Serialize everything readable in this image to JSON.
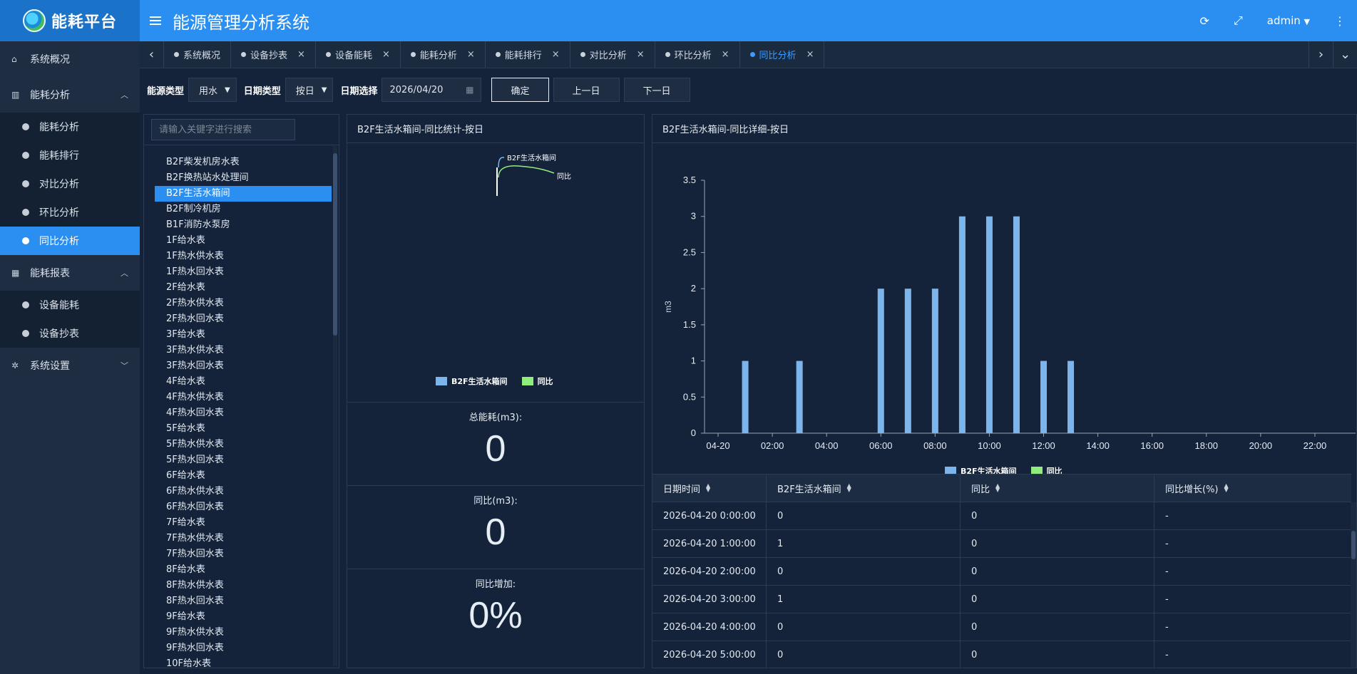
{
  "header": {
    "logo_text": "能耗平台",
    "title": "能源管理分析系统",
    "user": "admin",
    "icons": [
      "refresh-icon",
      "fullscreen-icon",
      "user-caret-icon",
      "more-icon"
    ]
  },
  "sidebar": {
    "groups": [
      {
        "label": "系统概况",
        "icon": "home-icon"
      },
      {
        "label": "能耗分析",
        "icon": "bar-chart-icon",
        "expanded": true,
        "items": [
          "能耗分析",
          "能耗排行",
          "对比分析",
          "环比分析",
          "同比分析"
        ],
        "active": 4
      },
      {
        "label": "能耗报表",
        "icon": "table-icon",
        "expanded": true,
        "items": [
          "设备能耗",
          "设备抄表"
        ]
      },
      {
        "label": "系统设置",
        "icon": "gear-icon",
        "expanded": false
      }
    ]
  },
  "tabs": {
    "items": [
      "系统概况",
      "设备抄表",
      "设备能耗",
      "能耗分析",
      "能耗排行",
      "对比分析",
      "环比分析",
      "同比分析"
    ],
    "active": 7
  },
  "filters": {
    "energy_type_label": "能源类型",
    "energy_type_value": "用水",
    "date_type_label": "日期类型",
    "date_type_value": "按日",
    "date_label": "日期选择",
    "date_value": "2026/04/20",
    "confirm": "确定",
    "prev": "上一日",
    "next": "下一日"
  },
  "tree": {
    "search_placeholder": "请输入关键字进行搜索",
    "selected_index": 2,
    "items": [
      "B2F柴发机房水表",
      "B2F换热站水处理间",
      "B2F生活水箱间",
      "B2F制冷机房",
      "B1F消防水泵房",
      "1F给水表",
      "1F热水供水表",
      "1F热水回水表",
      "2F给水表",
      "2F热水供水表",
      "2F热水回水表",
      "3F给水表",
      "3F热水供水表",
      "3F热水回水表",
      "4F给水表",
      "4F热水供水表",
      "4F热水回水表",
      "5F给水表",
      "5F热水供水表",
      "5F热水回水表",
      "6F给水表",
      "6F热水供水表",
      "6F热水回水表",
      "7F给水表",
      "7F热水供水表",
      "7F热水回水表",
      "8F给水表",
      "8F热水供水表",
      "8F热水回水表",
      "9F给水表",
      "9F热水供水表",
      "9F热水回水表",
      "10F给水表"
    ]
  },
  "stats": {
    "title": "B2F生活水箱间-同比统计-按日",
    "pie_labels": [
      "B2F生活水箱间",
      "同比"
    ],
    "legend": [
      "B2F生活水箱间",
      "同比"
    ],
    "colors": {
      "series1": "#7cb5ec",
      "series2": "#90ed7d"
    },
    "total_label": "总能耗(m3):",
    "total_value": "0",
    "yoy_label": "同比(m3):",
    "yoy_value": "0",
    "increase_label": "同比增加:",
    "increase_value": "0%"
  },
  "detail": {
    "title": "B2F生活水箱间-同比详细-按日",
    "chart_data": {
      "type": "bar",
      "ylabel": "m3",
      "ylim": [
        0,
        3.5
      ],
      "yticks": [
        "0",
        "0.5",
        "1",
        "1.5",
        "2",
        "2.5",
        "3",
        "3.5"
      ],
      "xticks": [
        "04-20",
        "02:00",
        "04:00",
        "06:00",
        "08:00",
        "10:00",
        "12:00",
        "14:00",
        "16:00",
        "18:00",
        "20:00",
        "22:00"
      ],
      "categories": [
        "0:00",
        "1:00",
        "2:00",
        "3:00",
        "4:00",
        "5:00",
        "6:00",
        "7:00",
        "8:00",
        "9:00",
        "10:00",
        "11:00",
        "12:00",
        "13:00",
        "14:00",
        "15:00",
        "16:00",
        "17:00",
        "18:00",
        "19:00",
        "20:00",
        "21:00",
        "22:00",
        "23:00"
      ],
      "series": [
        {
          "name": "B2F生活水箱间",
          "color": "#7cb5ec",
          "values": [
            0,
            1,
            0,
            1,
            0,
            0,
            2,
            2,
            2,
            3,
            3,
            3,
            1,
            1,
            0,
            0,
            0,
            0,
            0,
            0,
            0,
            0,
            0,
            0
          ]
        },
        {
          "name": "同比",
          "color": "#90ed7d",
          "values": [
            0,
            0,
            0,
            0,
            0,
            0,
            0,
            0,
            0,
            0,
            0,
            0,
            0,
            0,
            0,
            0,
            0,
            0,
            0,
            0,
            0,
            0,
            0,
            0
          ]
        }
      ],
      "legend": [
        "B2F生活水箱间",
        "同比"
      ]
    },
    "table": {
      "headers": [
        "日期时间",
        "B2F生活水箱间",
        "同比",
        "同比增长(%)"
      ],
      "rows": [
        [
          "2026-04-20 0:00:00",
          "0",
          "0",
          "-"
        ],
        [
          "2026-04-20 1:00:00",
          "1",
          "0",
          "-"
        ],
        [
          "2026-04-20 2:00:00",
          "0",
          "0",
          "-"
        ],
        [
          "2026-04-20 3:00:00",
          "1",
          "0",
          "-"
        ],
        [
          "2026-04-20 4:00:00",
          "0",
          "0",
          "-"
        ],
        [
          "2026-04-20 5:00:00",
          "0",
          "0",
          "-"
        ]
      ]
    }
  }
}
